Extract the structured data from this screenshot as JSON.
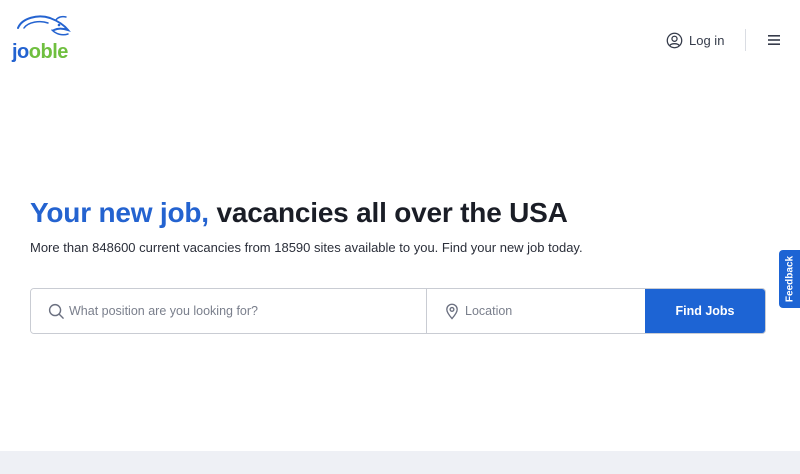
{
  "header": {
    "logo": {
      "text_part1": "jo",
      "text_part2": "oble",
      "icon": "jooble-fish-logo-icon"
    },
    "login_label": "Log in",
    "login_icon": "user-circle-icon",
    "menu_icon": "hamburger-menu-icon"
  },
  "hero": {
    "headline_accent": "Your new job,",
    "headline_rest": " vacancies all over the USA",
    "subline": "More than 848600 current vacancies from 18590 sites available to you. Find your new job today."
  },
  "search": {
    "position_placeholder": "What position are you looking for?",
    "position_value": "",
    "position_icon": "search-icon",
    "location_placeholder": "Location",
    "location_value": "",
    "location_icon": "location-pin-icon",
    "button_label": "Find Jobs"
  },
  "feedback": {
    "label": "Feedback"
  },
  "colors": {
    "brand_blue": "#1d64d4",
    "headline_accent": "#2463d0",
    "logo_green": "#6fbf3f",
    "footer_bg": "#eef0f5"
  }
}
